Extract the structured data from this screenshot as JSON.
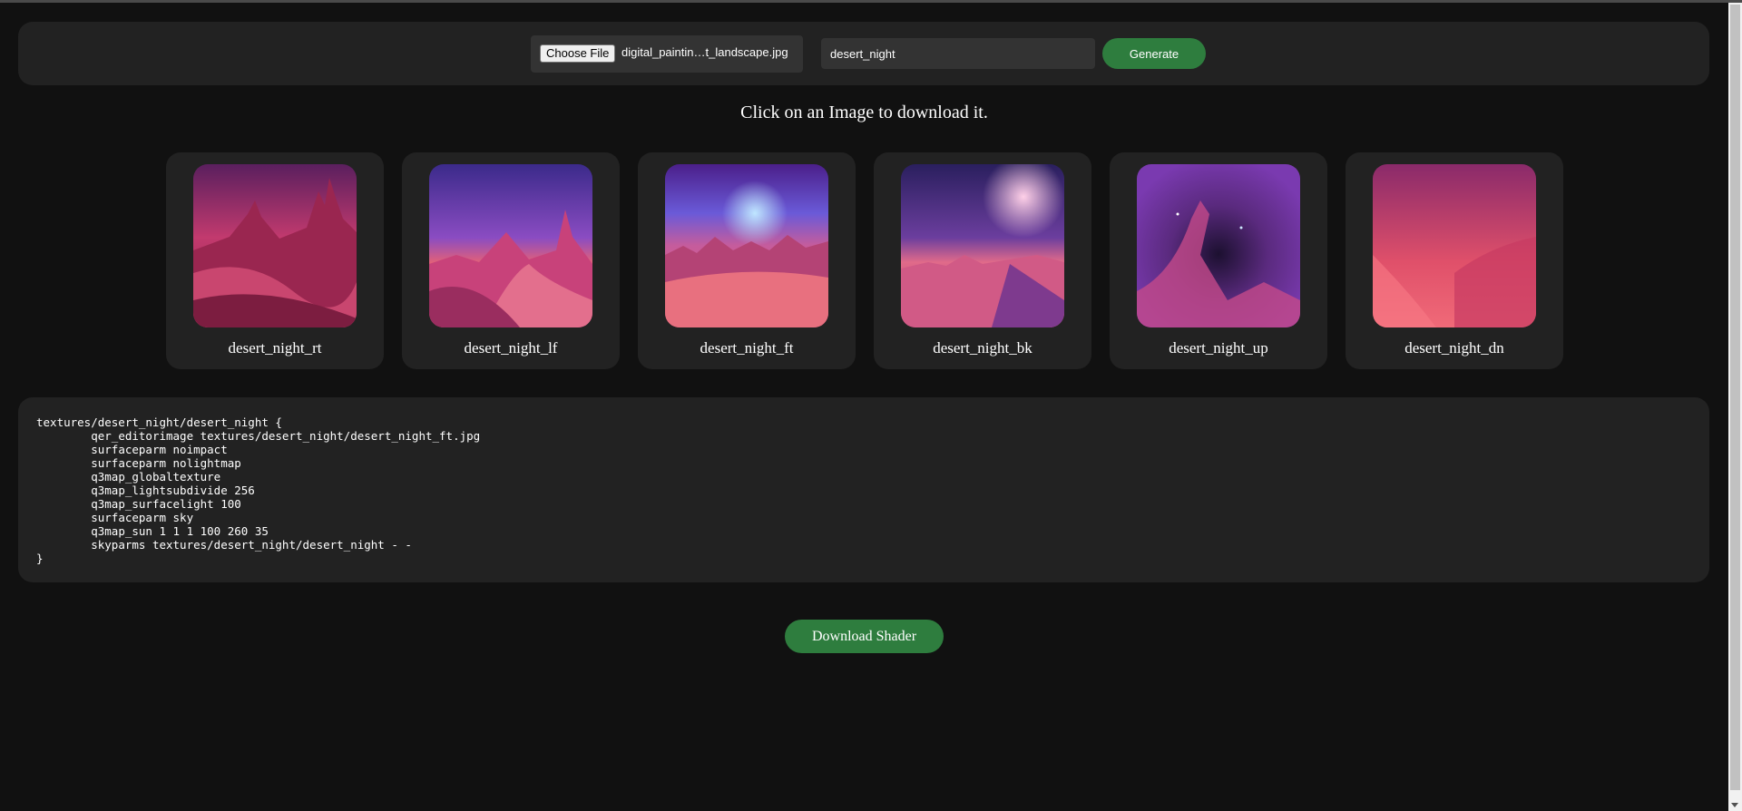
{
  "toolbar": {
    "choose_file_label": "Choose File",
    "file_name": "digital_paintin…t_landscape.jpg",
    "name_value": "desert_night",
    "generate_label": "Generate"
  },
  "instruction": "Click on an Image to download it.",
  "images": [
    {
      "label": "desert_night_rt",
      "icon": "desert-rt-image"
    },
    {
      "label": "desert_night_lf",
      "icon": "desert-lf-image"
    },
    {
      "label": "desert_night_ft",
      "icon": "desert-ft-image"
    },
    {
      "label": "desert_night_bk",
      "icon": "desert-bk-image"
    },
    {
      "label": "desert_night_up",
      "icon": "desert-up-image"
    },
    {
      "label": "desert_night_dn",
      "icon": "desert-dn-image"
    }
  ],
  "shader_code": "textures/desert_night/desert_night {\n\tqer_editorimage textures/desert_night/desert_night_ft.jpg\n\tsurfaceparm noimpact\n\tsurfaceparm nolightmap\n\tq3map_globaltexture\n\tq3map_lightsubdivide 256\n\tq3map_surfacelight 100\n\tsurfaceparm sky\n\tq3map_sun 1 1 1 100 260 35\n\tskyparms textures/desert_night/desert_night - -\n}",
  "download_shader_label": "Download Shader",
  "colors": {
    "background": "#111111",
    "panel": "#222222",
    "accent_green": "#2e7d3e"
  }
}
